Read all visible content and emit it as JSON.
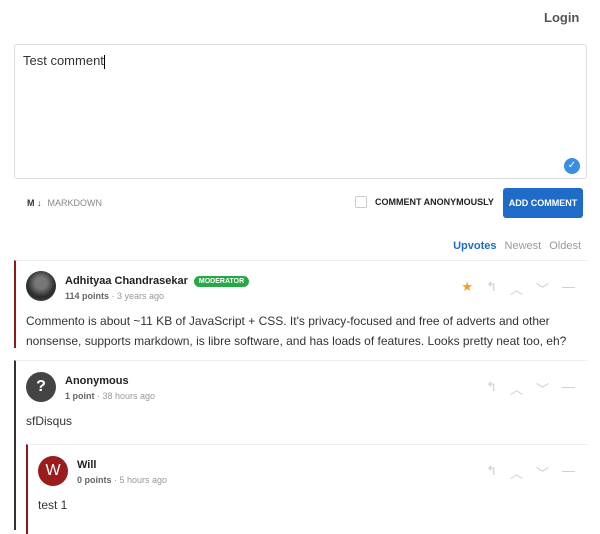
{
  "header": {
    "login": "Login"
  },
  "editor": {
    "value": "Test comment",
    "markdown_icon": "M ↓",
    "markdown_label": "MARKDOWN",
    "anonymous_label": "COMMENT ANONYMOUSLY",
    "anonymous_checked": false,
    "submit": "ADD COMMENT"
  },
  "sort": {
    "options": [
      "Upvotes",
      "Newest",
      "Oldest"
    ],
    "selected": "Upvotes"
  },
  "comments": [
    {
      "author": "Adhityaa Chandrasekar",
      "badge": "MODERATOR",
      "points": "114 points",
      "time": "3 years ago",
      "body": "Commento is about ~11 KB of JavaScript + CSS. It's privacy-focused and free of adverts and other nonsense, supports markdown, is libre software, and has loads of features. Looks pretty neat too, eh?",
      "sticky": true
    },
    {
      "author": "Anonymous",
      "avatar": "?",
      "points": "1 point",
      "time": "38 hours ago",
      "body": "sfDisqus"
    },
    {
      "author": "Will",
      "avatar": "W",
      "points": "0 points",
      "time": "5 hours ago",
      "body": "test 1"
    }
  ],
  "colors": {
    "accent": "#1e6cc7",
    "moderator": "#27a846",
    "will_avatar": "#9b1c1c"
  }
}
